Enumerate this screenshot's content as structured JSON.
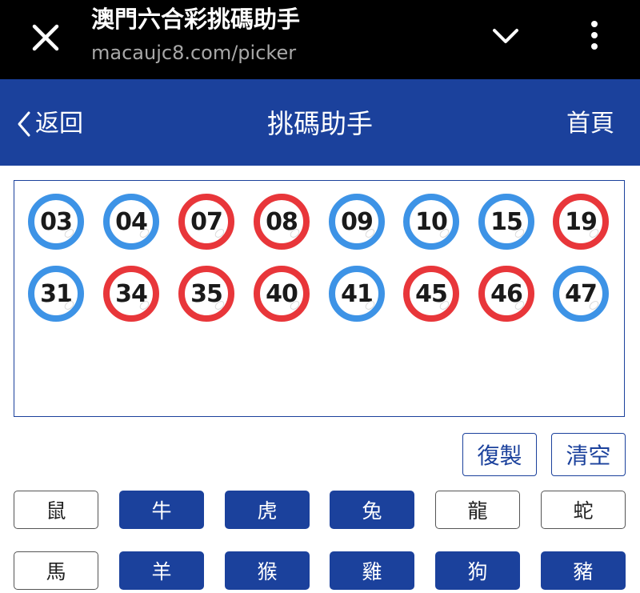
{
  "browser_bar": {
    "title": "澳門六合彩挑碼助手",
    "url": "macaujc8.com/picker"
  },
  "header": {
    "back_label": "返回",
    "title": "挑碼助手",
    "home_label": "首頁",
    "color": "#1b419c"
  },
  "balls": [
    {
      "num": "03",
      "color": "blue"
    },
    {
      "num": "04",
      "color": "blue"
    },
    {
      "num": "07",
      "color": "red"
    },
    {
      "num": "08",
      "color": "red"
    },
    {
      "num": "09",
      "color": "blue"
    },
    {
      "num": "10",
      "color": "blue"
    },
    {
      "num": "15",
      "color": "blue"
    },
    {
      "num": "19",
      "color": "red"
    },
    {
      "num": "31",
      "color": "blue"
    },
    {
      "num": "34",
      "color": "red"
    },
    {
      "num": "35",
      "color": "red"
    },
    {
      "num": "40",
      "color": "red"
    },
    {
      "num": "41",
      "color": "blue"
    },
    {
      "num": "45",
      "color": "red"
    },
    {
      "num": "46",
      "color": "red"
    },
    {
      "num": "47",
      "color": "blue"
    }
  ],
  "ball_colors": {
    "blue": "#3d93e6",
    "red": "#e8363a"
  },
  "actions": {
    "copy_label": "復製",
    "clear_label": "清空"
  },
  "zodiac": [
    {
      "label": "鼠",
      "selected": false
    },
    {
      "label": "牛",
      "selected": true
    },
    {
      "label": "虎",
      "selected": true
    },
    {
      "label": "兔",
      "selected": true
    },
    {
      "label": "龍",
      "selected": false
    },
    {
      "label": "蛇",
      "selected": false
    },
    {
      "label": "馬",
      "selected": false
    },
    {
      "label": "羊",
      "selected": true
    },
    {
      "label": "猴",
      "selected": true
    },
    {
      "label": "雞",
      "selected": true
    },
    {
      "label": "狗",
      "selected": true
    },
    {
      "label": "豬",
      "selected": true
    }
  ]
}
